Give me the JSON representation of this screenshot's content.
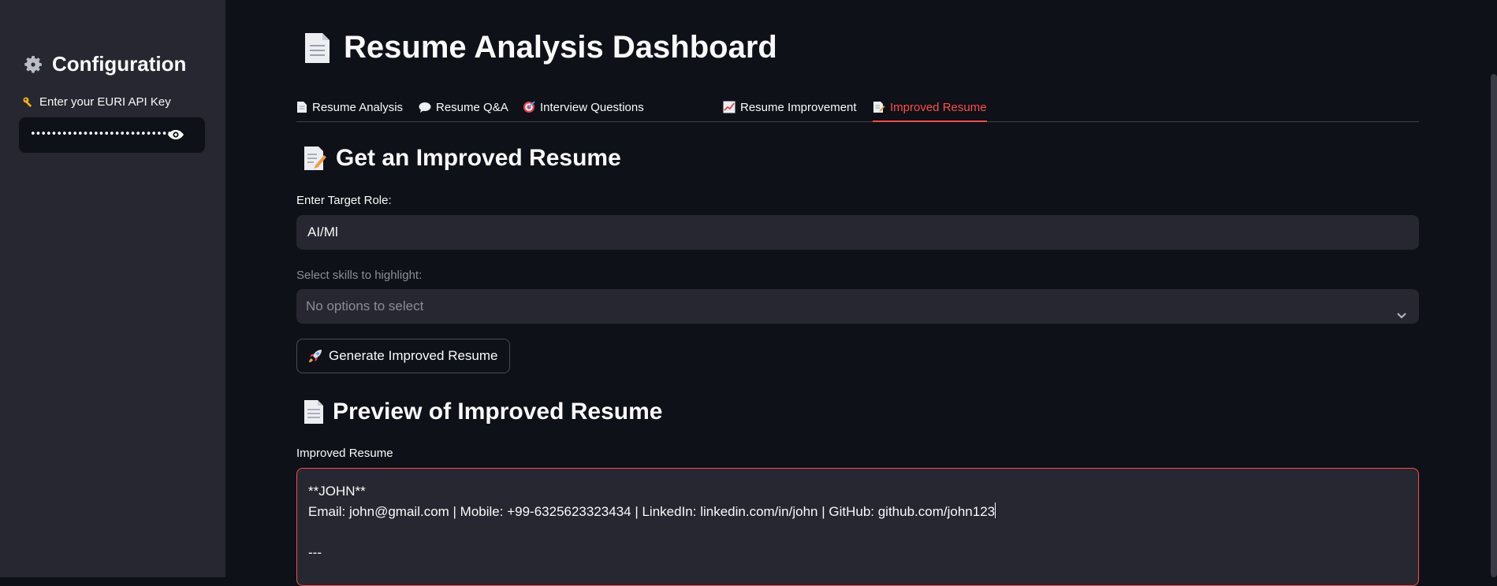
{
  "sidebar": {
    "title": "Configuration",
    "api_key_label": "Enter your EURI API Key",
    "api_key_masked": "••••••••••••••••••••••••••••••••••"
  },
  "page": {
    "title": "Resume Analysis Dashboard"
  },
  "tabs": [
    {
      "label": "Resume Analysis",
      "icon": "page-icon"
    },
    {
      "label": "Resume Q&A",
      "icon": "speech-bubble-icon"
    },
    {
      "label": "Interview Questions",
      "icon": "target-icon"
    },
    {
      "label": "Resume Improvement",
      "icon": "chart-increasing-icon"
    },
    {
      "label": "Improved Resume",
      "icon": "memo-icon",
      "active": true
    }
  ],
  "improve_section": {
    "heading": "Get an Improved Resume",
    "target_role_label": "Enter Target Role:",
    "target_role_value": "AI/Ml",
    "skills_label": "Select skills to highlight:",
    "skills_placeholder": "No options to select",
    "generate_button": "Generate Improved Resume"
  },
  "preview_section": {
    "heading": "Preview of Improved Resume",
    "textarea_label": "Improved Resume",
    "lines": [
      "**JOHN**",
      "Email: john@gmail.com | Mobile: +99-6325623323434 | LinkedIn: linkedin.com/in/john | GitHub: github.com/john123",
      "",
      "---"
    ]
  },
  "colors": {
    "background": "#0e1117",
    "sidebar": "#262730",
    "accent": "#ff4b4b",
    "input": "#262730"
  }
}
